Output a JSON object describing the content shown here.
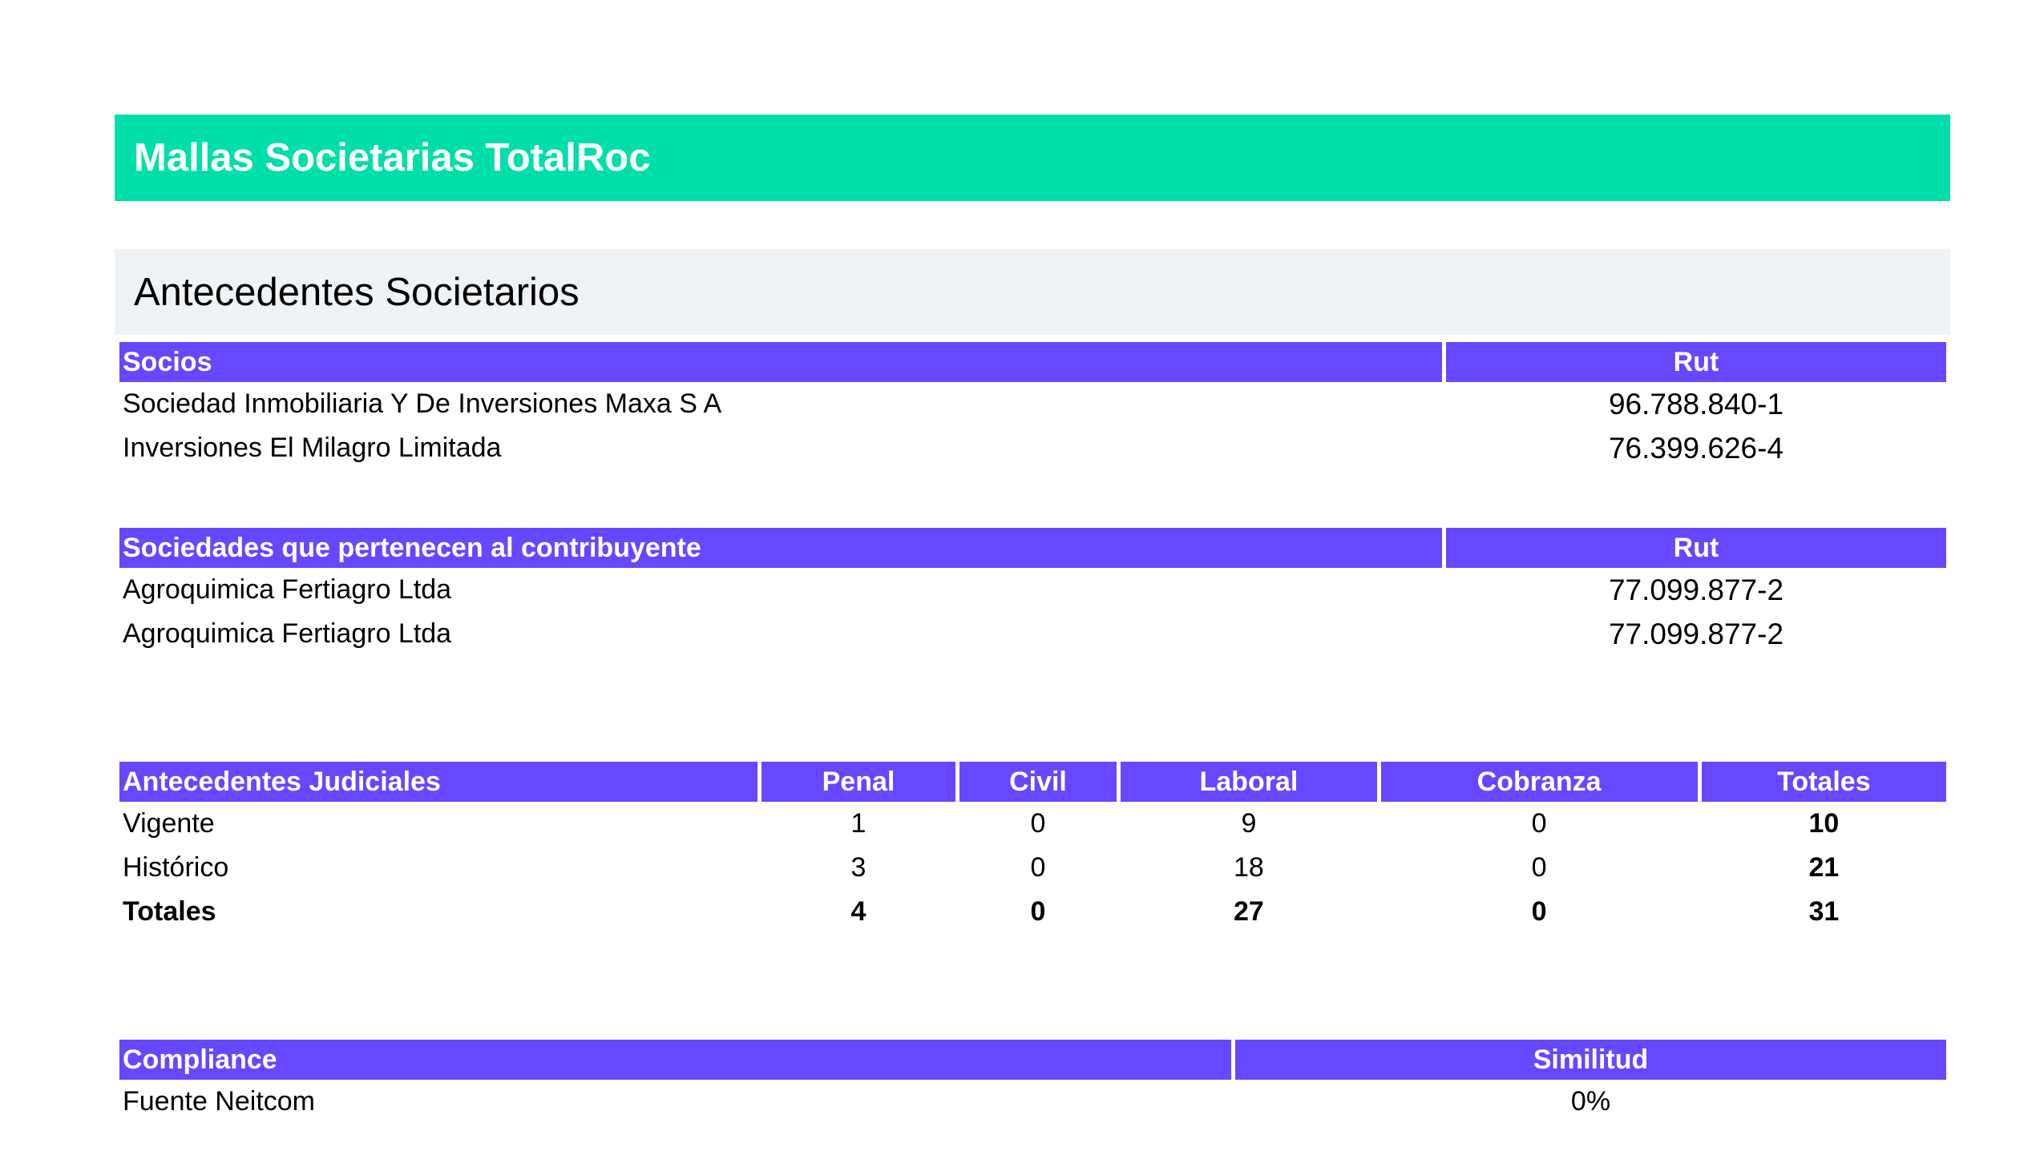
{
  "header": {
    "title": "Mallas Societarias TotalRoc"
  },
  "section": {
    "title": "Antecedentes Societarios"
  },
  "socios": {
    "headers": [
      "Socios",
      "Rut"
    ],
    "rows": [
      {
        "name": "Sociedad Inmobiliaria Y De Inversiones Maxa S A",
        "rut": "96.788.840-1"
      },
      {
        "name": "Inversiones El Milagro Limitada",
        "rut": "76.399.626-4"
      }
    ]
  },
  "sociedades": {
    "headers": [
      "Sociedades que pertenecen al contribuyente",
      "Rut"
    ],
    "rows": [
      {
        "name": "Agroquimica Fertiagro Ltda",
        "rut": "77.099.877-2"
      },
      {
        "name": "Agroquimica Fertiagro Ltda",
        "rut": "77.099.877-2"
      }
    ]
  },
  "judiciales": {
    "headers": [
      "Antecedentes Judiciales",
      "Penal",
      "Civil",
      "Laboral",
      "Cobranza",
      "Totales"
    ],
    "rows": [
      {
        "label": "Vigente",
        "values": [
          "1",
          "0",
          "9",
          "0",
          "10"
        ]
      },
      {
        "label": "Histórico",
        "values": [
          "3",
          "0",
          "18",
          "0",
          "21"
        ]
      },
      {
        "label": "Totales",
        "values": [
          "4",
          "0",
          "27",
          "0",
          "31"
        ]
      }
    ]
  },
  "compliance": {
    "headers": [
      "Compliance",
      "Similitud"
    ],
    "rows": [
      {
        "source": "Fuente Neitcom",
        "similarity": "0%"
      }
    ]
  },
  "colors": {
    "banner": "#00dea9",
    "section_band": "#f0f3f6",
    "table_header": "#6548ff"
  }
}
